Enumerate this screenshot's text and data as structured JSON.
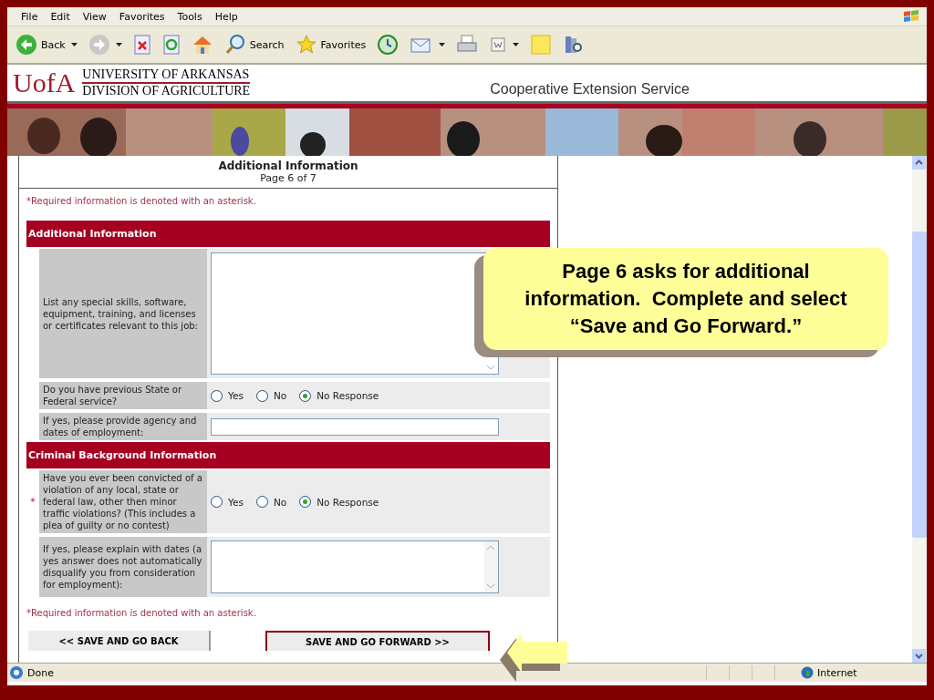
{
  "menu": [
    "File",
    "Edit",
    "View",
    "Favorites",
    "Tools",
    "Help"
  ],
  "toolbar": [
    {
      "kind": "back",
      "label": "Back",
      "dropdown": true
    },
    {
      "kind": "forward",
      "dropdown": true
    },
    {
      "kind": "stop"
    },
    {
      "kind": "refresh"
    },
    {
      "kind": "home"
    },
    {
      "kind": "search",
      "label": "Search"
    },
    {
      "kind": "favorites",
      "label": "Favorites"
    },
    {
      "kind": "history"
    },
    {
      "kind": "mail",
      "dropdown": true
    },
    {
      "kind": "print"
    },
    {
      "kind": "word",
      "dropdown": true
    },
    {
      "kind": "note"
    },
    {
      "kind": "research"
    }
  ],
  "site_header": {
    "logo": "UofA",
    "line_1": "UNIVERSITY OF ARKANSAS",
    "line_2": "DIVISION OF AGRICULTURE",
    "service": "Cooperative Extension Service"
  },
  "form": {
    "title": "Additional Information",
    "page": "Page 6 of 7",
    "note_top": "*Required information is denoted with an asterisk.",
    "sections": [
      {
        "title": "Additional Information",
        "rows": [
          {
            "kind": "textarea",
            "label": "List any special skills, software, equipment, training, and licenses or certificates relevant to this job:",
            "tall": true
          },
          {
            "kind": "radio",
            "label": "Do you have previous State or Federal service?",
            "options": [
              {
                "label": "Yes",
                "selected": false
              },
              {
                "label": "No",
                "selected": false
              },
              {
                "label": "No Response",
                "selected": true
              }
            ]
          },
          {
            "kind": "text",
            "label": "If yes, please provide agency and dates of employment:"
          }
        ]
      },
      {
        "title": "Criminal Background Information",
        "rows": [
          {
            "kind": "radio",
            "marker": "*",
            "label": "Have you ever been convicted of a violation of any local, state or federal law, other then minor traffic violations? (This includes a plea of guilty or no contest)",
            "options": [
              {
                "label": "Yes",
                "selected": false
              },
              {
                "label": "No",
                "selected": false
              },
              {
                "label": "No Response",
                "selected": true
              }
            ]
          },
          {
            "kind": "textarea",
            "label": "If yes, please explain with dates (a yes answer does not automatically disqualify you from consideration for employment):",
            "tall": false
          }
        ]
      }
    ],
    "note_bottom": "*Required information is denoted with an asterisk.",
    "buttons": [
      {
        "label": "<< SAVE AND GO BACK",
        "primary": false
      },
      {
        "label": "SAVE AND GO FORWARD >>",
        "primary": true
      }
    ]
  },
  "callout": "Page 6 asks for additional information.  Complete and select “Save and Go Forward.”",
  "status_bar": {
    "text": "Done",
    "zone": "Internet"
  }
}
